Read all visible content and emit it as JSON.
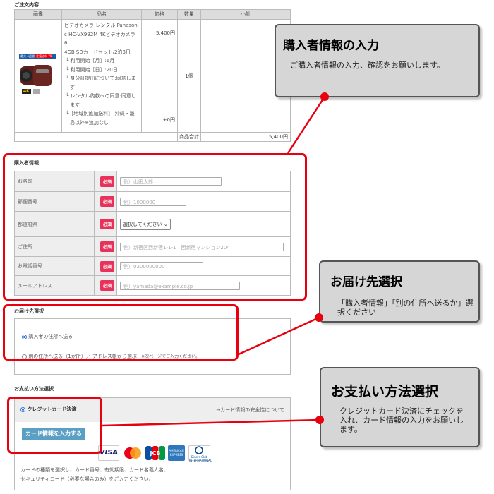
{
  "order": {
    "section_title": "ご注文内容",
    "headers": [
      "画像",
      "品名",
      "価格",
      "数量",
      "小計"
    ],
    "product_name_lines": [
      "ビデオカメラ レンタル Panasoni",
      "c HC-VX992M 4Kビデオカメラ 6",
      "4GB SDカードセット/2泊3日"
    ],
    "options": [
      "└ 利用開始［月］:6月",
      "└ 利用開始［日］:20日",
      "└ 身分証提出について:同意しま",
      "す",
      "└ レンタル約款への同意:同意し",
      "ます",
      "└［地域別追加送料］:沖縄・離",
      "島以外※追加なし"
    ],
    "price": "5,400円",
    "extra_price": "+0円",
    "quantity": "1個",
    "subtotal": "5,4",
    "total_label": "商品合計",
    "total_value": "5,400円",
    "badge_top": "最大 4週間",
    "badge_top2": "往復送料 ¥0",
    "badge_4k": "4K"
  },
  "buyer": {
    "section_title": "購入者情報",
    "required": "必須",
    "rows": [
      {
        "label": "お名前",
        "placeholder": "例）山田太郎"
      },
      {
        "label": "郵便番号",
        "placeholder": "例）1000000"
      },
      {
        "label": "都道府県",
        "select": "選択してください"
      },
      {
        "label": "ご住所",
        "placeholder": "例）新宿区西新宿1-1-1　西新宿マンション204"
      },
      {
        "label": "お電話番号",
        "placeholder": "例）0300000000"
      },
      {
        "label": "メールアドレス",
        "placeholder": "例）yamada@example.co.jp"
      }
    ]
  },
  "delivery": {
    "section_title": "お届け先選択",
    "option1": "購入者の住所へ送る",
    "option2": "別の住所へ送る（1か所）／ アドレス帳から選ぶ",
    "option2_note": "※次ページでご入力ください。"
  },
  "payment": {
    "section_title": "お支払い方法選択",
    "method": "クレジットカード決済",
    "security_link": "→カード情報の安全性について",
    "enter_button": "カード情報を入力する",
    "cards": [
      "VISA",
      "Mastercard",
      "JCB",
      "AMERICAN EXPRESS",
      "Diners Club INTERNATIONAL"
    ],
    "help_line1": "カードの種類を選択し、カード番号、有効期限、カード名義人名、",
    "help_line2": "セキュリティコード（必要な場合のみ）をご入力ください。"
  },
  "callouts": {
    "buyer": {
      "title": "購入者情報の入力",
      "body": "ご購入者情報の入力、確認をお願いします。"
    },
    "delivery": {
      "title": "お届け先選択",
      "body": "「購入者情報」「別の住所へ送るか」選択ください"
    },
    "payment": {
      "title": "お支払い方法選択",
      "body": "クレジットカード決済にチェックを入れ、カード情報の入力をお願いします。"
    }
  },
  "colors": {
    "highlight": "#e8000f",
    "required_badge": "#e8325a",
    "button": "#5b9fc4"
  }
}
